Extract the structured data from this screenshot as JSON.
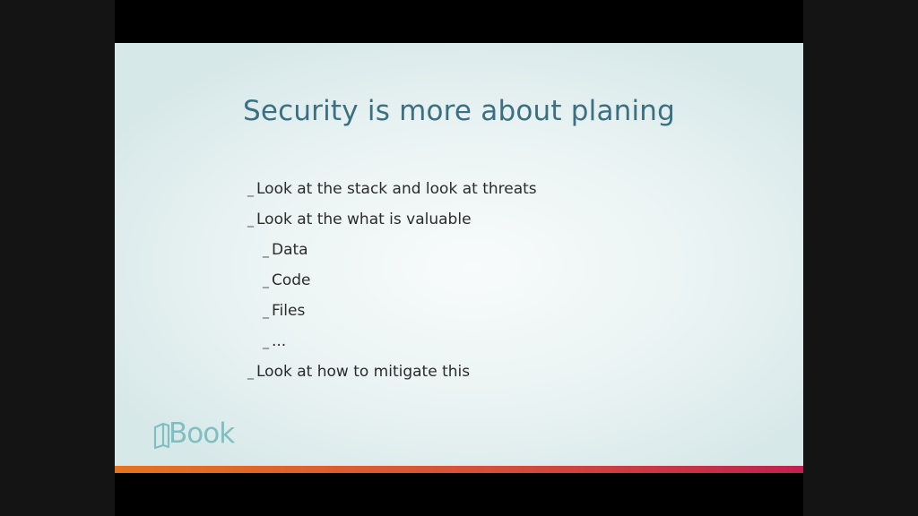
{
  "slide": {
    "title": "Security is more about planing",
    "bullets": [
      {
        "marker": "_",
        "text": "Look at the stack and look at threats",
        "level": 0
      },
      {
        "marker": "_",
        "text": "Look at the what is valuable",
        "level": 0
      },
      {
        "marker": "_",
        "text": "Data",
        "level": 1
      },
      {
        "marker": "_",
        "text": "Code",
        "level": 1
      },
      {
        "marker": "_",
        "text": "Files",
        "level": 1
      },
      {
        "marker": "_",
        "text": "...",
        "level": 1
      },
      {
        "marker": "_",
        "text": "Look at how to mitigate this",
        "level": 0
      }
    ],
    "logo_text": "Book",
    "logo_icon": "book-outline-icon"
  },
  "colors": {
    "title": "#3b6f82",
    "logo": "#7fbfc2",
    "accent_start": "#e5741e",
    "accent_end": "#c0214f"
  }
}
